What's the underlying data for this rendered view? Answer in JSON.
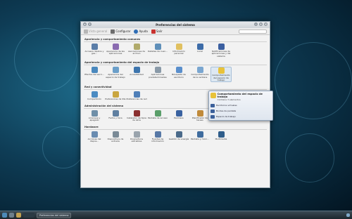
{
  "window": {
    "title": "Preferencias del sistema",
    "toolbar": {
      "back_label": "Vista general",
      "configure_label": "Configurar",
      "help_label": "Ayuda",
      "quit_label": "Salir"
    },
    "sections": [
      {
        "header": "Apariencia y comportamiento comunes",
        "items": [
          {
            "label": "Accesos rápidos y ges...",
            "icon": "shortcuts-icon",
            "color": "#5a7da8"
          },
          {
            "label": "Apariencia de las aplicaciones",
            "icon": "app-appearance-icon",
            "color": "#8a6bb0"
          },
          {
            "label": "Asociaciones de archivo",
            "icon": "file-association-icon",
            "color": "#b0aa6b"
          },
          {
            "label": "Detalles de cuen...",
            "icon": "account-icon",
            "color": "#5f8fb9"
          },
          {
            "label": "Información personal",
            "icon": "personal-info-icon",
            "color": "#e0c060"
          },
          {
            "label": "Local",
            "icon": "locale-icon",
            "color": "#3d6ca8"
          },
          {
            "label": "Notificaciones de aplicaciones y del sistema",
            "icon": "notifications-icon",
            "color": "#3b5fa0"
          }
        ]
      },
      {
        "header": "Apariencia y comportamiento del espacio de trabajo",
        "items": [
          {
            "label": "Efectos del escri...",
            "icon": "desktop-effects-icon",
            "color": "#4a88bd"
          },
          {
            "label": "Apariencia del espacio de trabajo",
            "icon": "workspace-appearance-icon",
            "color": "#6b9fc9"
          },
          {
            "label": "Accesibilidad",
            "icon": "accessibility-icon",
            "color": "#3d75ad"
          },
          {
            "label": "Aplicaciones predeterminadas",
            "icon": "default-apps-icon",
            "color": "#8a9aa8"
          },
          {
            "label": "Búsqueda de escritorio",
            "icon": "desktop-search-icon",
            "color": "#5a8fcc"
          },
          {
            "label": "Comportamiento de la ventana",
            "icon": "window-behavior-icon",
            "color": "#7aa6d0"
          },
          {
            "label": "Comportamiento del espacio de trabajo",
            "icon": "workspace-behavior-icon",
            "color": "#e8c23a"
          }
        ]
      },
      {
        "header": "Red y conectividad",
        "items": [
          {
            "label": "Compartición",
            "icon": "sharing-icon",
            "color": "#4b8bc2"
          },
          {
            "label": "Preferencias de SSL",
            "icon": "ssl-icon",
            "color": "#c9a640"
          },
          {
            "label": "Preferencias de red",
            "icon": "network-icon",
            "color": "#4f7fb8"
          }
        ]
      },
      {
        "header": "Administración del sistema",
        "items": [
          {
            "label": "Arranque y apagado",
            "icon": "startup-icon",
            "color": "#6f8fa8"
          },
          {
            "label": "Fecha y hora",
            "icon": "clock-icon",
            "color": "#5f7fa0"
          },
          {
            "label": "Instalador de tipos de letra",
            "icon": "font-installer-icon",
            "color": "#8a2f2f"
          },
          {
            "label": "Pantalla de acceso",
            "icon": "login-screen-icon",
            "color": "#5a9e6a"
          },
          {
            "label": "Permisos",
            "icon": "permissions-icon",
            "color": "#3a62a0"
          },
          {
            "label": "Planificador de tareas",
            "icon": "task-scheduler-icon",
            "color": "#c08a3a"
          }
        ]
      },
      {
        "header": "Hardware",
        "items": [
          {
            "label": "Acciones del dispos...",
            "icon": "device-actions-icon",
            "color": "#6a8cb0"
          },
          {
            "label": "Dispositivos de entrada",
            "icon": "input-devices-icon",
            "color": "#7a8a96"
          },
          {
            "label": "Dispositivos extraíbles",
            "icon": "removable-devices-icon",
            "color": "#9aa4ad"
          },
          {
            "label": "Fuentes de información",
            "icon": "info-sources-icon",
            "color": "#5778a6"
          },
          {
            "label": "Gestión de energía",
            "icon": "power-icon",
            "color": "#4a6a8a"
          },
          {
            "label": "Pantalla y moni...",
            "icon": "display-icon",
            "color": "#3f6c9e"
          },
          {
            "label": "Multimedia",
            "icon": "multimedia-icon",
            "color": "#2f5d8a"
          }
        ]
      }
    ]
  },
  "popup": {
    "title": "Comportamiento del espacio de trabajo",
    "subtitle": "Contiene 3 elementos",
    "rows": [
      "Escritorios virtuales",
      "Bordes de pantalla",
      "Espacio de trabajo"
    ]
  },
  "taskbar": {
    "task_label": "Preferencias del sistema"
  },
  "colors": {
    "accent": "#3a5f9a",
    "highlight": "#dde8f2"
  }
}
